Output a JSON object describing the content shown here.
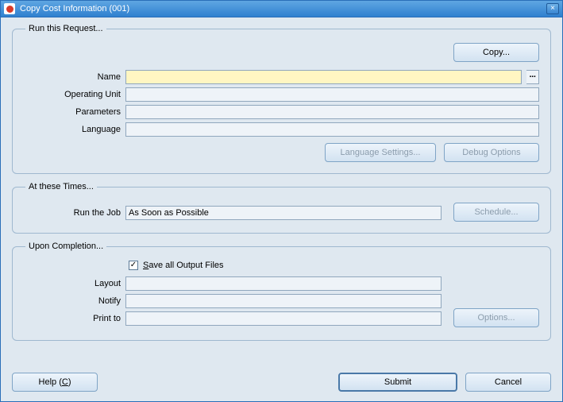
{
  "window": {
    "title": "Copy Cost Information (001)"
  },
  "group1": {
    "legend": "Run this Request...",
    "copy_label": "Copy...",
    "labels": {
      "name": "Name",
      "operating_unit": "Operating Unit",
      "parameters": "Parameters",
      "language": "Language"
    },
    "values": {
      "name": "",
      "operating_unit": "",
      "parameters": "",
      "language": ""
    },
    "lang_settings_label": "Language Settings...",
    "debug_options_label": "Debug Options"
  },
  "group2": {
    "legend": "At these Times...",
    "labels": {
      "run_the_job": "Run the Job"
    },
    "values": {
      "run_the_job": "As Soon as Possible"
    },
    "schedule_label": "Schedule..."
  },
  "group3": {
    "legend": "Upon Completion...",
    "save_all_label_prefix": "S",
    "save_all_label_rest": "ave all Output Files",
    "save_all_checked": true,
    "labels": {
      "layout": "Layout",
      "notify": "Notify",
      "print_to": "Print to"
    },
    "values": {
      "layout": "",
      "notify": "",
      "print_to": ""
    },
    "options_label": "Options..."
  },
  "footer": {
    "help_prefix": "Help (",
    "help_key": "C",
    "help_suffix": ")",
    "submit_label": "Submit",
    "cancel_label": "Cancel"
  }
}
